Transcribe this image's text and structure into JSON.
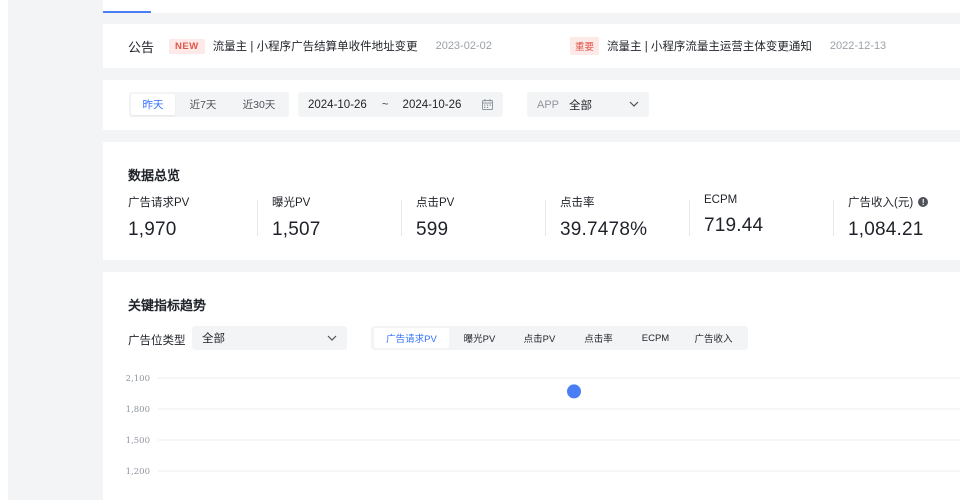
{
  "notice": {
    "title": "公告",
    "items": [
      {
        "badge": "NEW",
        "text": "流量主 | 小程序广告结算单收件地址变更",
        "date": "2023-02-02"
      },
      {
        "badge": "重要",
        "text": "流量主 | 小程序流量主运营主体变更通知",
        "date": "2022-12-13"
      }
    ]
  },
  "filter": {
    "ranges": [
      "昨天",
      "近7天",
      "近30天"
    ],
    "active_range": "昨天",
    "date_start": "2024-10-26",
    "date_sep": "~",
    "date_end": "2024-10-26",
    "app_label": "APP",
    "app_value": "全部"
  },
  "overview": {
    "title": "数据总览",
    "kpis": [
      {
        "label": "广告请求PV",
        "value": "1,970"
      },
      {
        "label": "曝光PV",
        "value": "1,507"
      },
      {
        "label": "点击PV",
        "value": "599"
      },
      {
        "label": "点击率",
        "value": "39.7478%"
      },
      {
        "label": "ECPM",
        "value": "719.44"
      },
      {
        "label": "广告收入(元)",
        "value": "1,084.21"
      }
    ],
    "info_glyph": "!"
  },
  "trend": {
    "title": "关键指标趋势",
    "position_label": "广告位类型",
    "position_value": "全部",
    "metric_tabs": [
      "广告请求PV",
      "曝光PV",
      "点击PV",
      "点击率",
      "ECPM",
      "广告收入"
    ],
    "active_metric": "广告请求PV"
  },
  "chart_data": {
    "type": "line",
    "y_ticks": [
      "2,100",
      "1,800",
      "1,500",
      "1,200"
    ],
    "ylim": [
      1200,
      2100
    ],
    "series": [
      {
        "values": [
          1970
        ]
      }
    ],
    "grid": true,
    "color": "#4a7ef5"
  }
}
